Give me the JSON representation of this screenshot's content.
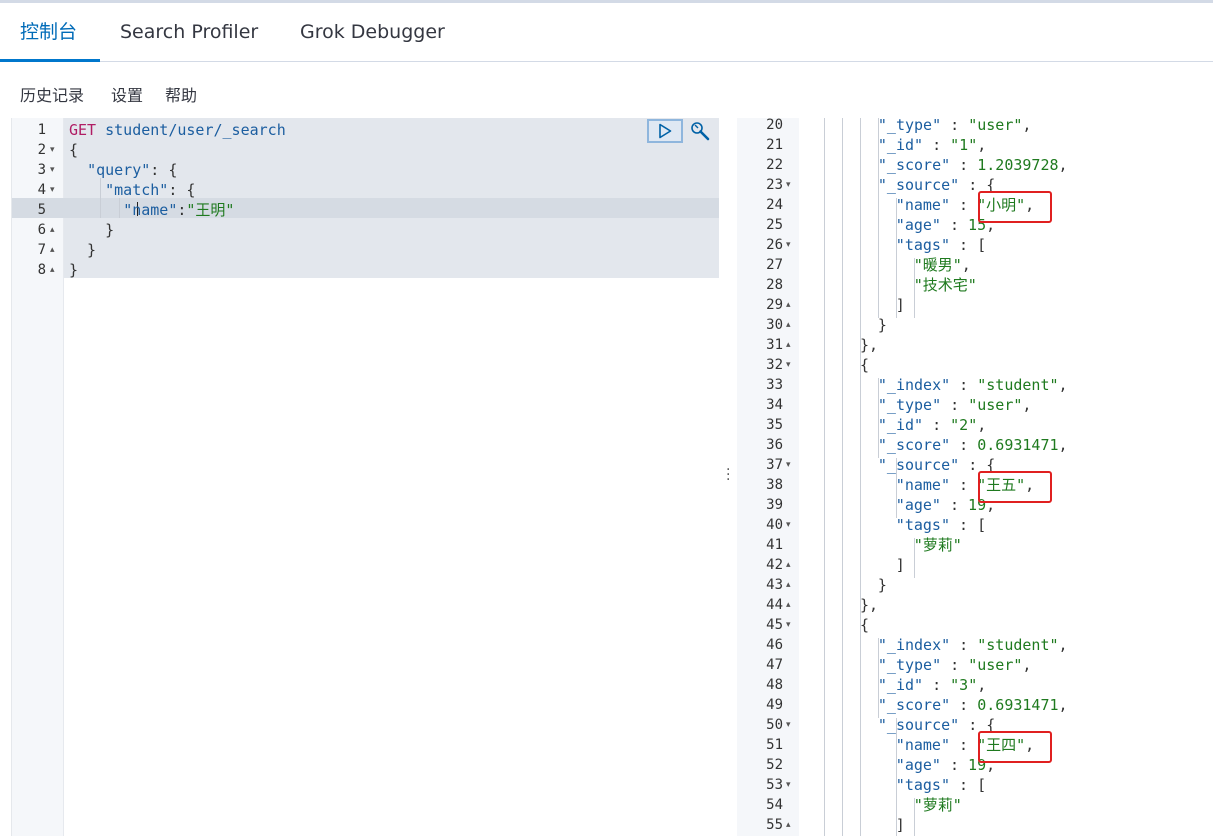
{
  "tabs": [
    {
      "label": "控制台",
      "active": true
    },
    {
      "label": "Search Profiler",
      "active": false
    },
    {
      "label": "Grok Debugger",
      "active": false
    }
  ],
  "menu": {
    "history": "历史记录",
    "settings": "设置",
    "help": "帮助"
  },
  "request": {
    "lines": [
      {
        "n": "1",
        "fold": "",
        "text": "GET student/user/_search"
      },
      {
        "n": "2",
        "fold": "▾",
        "text": "{"
      },
      {
        "n": "3",
        "fold": "▾",
        "text": "  \"query\": {"
      },
      {
        "n": "4",
        "fold": "▾",
        "text": "    \"match\": {"
      },
      {
        "n": "5",
        "fold": "",
        "text": "      \"name\":\"王明\""
      },
      {
        "n": "6",
        "fold": "▴",
        "text": "    }"
      },
      {
        "n": "7",
        "fold": "▴",
        "text": "  }"
      },
      {
        "n": "8",
        "fold": "▴",
        "text": "}"
      }
    ]
  },
  "response": {
    "lines": [
      {
        "n": "20",
        "fold": "",
        "indent": 4,
        "text": "\"_type\" : \"user\","
      },
      {
        "n": "21",
        "fold": "",
        "indent": 4,
        "text": "\"_id\" : \"1\","
      },
      {
        "n": "22",
        "fold": "",
        "indent": 4,
        "text": "\"_score\" : 1.2039728,"
      },
      {
        "n": "23",
        "fold": "▾",
        "indent": 4,
        "text": "\"_source\" : {"
      },
      {
        "n": "24",
        "fold": "",
        "indent": 5,
        "text": "\"name\" : \"小明\","
      },
      {
        "n": "25",
        "fold": "",
        "indent": 5,
        "text": "\"age\" : 15,"
      },
      {
        "n": "26",
        "fold": "▾",
        "indent": 5,
        "text": "\"tags\" : ["
      },
      {
        "n": "27",
        "fold": "",
        "indent": 6,
        "text": "\"暖男\","
      },
      {
        "n": "28",
        "fold": "",
        "indent": 6,
        "text": "\"技术宅\""
      },
      {
        "n": "29",
        "fold": "▴",
        "indent": 5,
        "text": "]"
      },
      {
        "n": "30",
        "fold": "▴",
        "indent": 4,
        "text": "}"
      },
      {
        "n": "31",
        "fold": "▴",
        "indent": 3,
        "text": "},"
      },
      {
        "n": "32",
        "fold": "▾",
        "indent": 3,
        "text": "{"
      },
      {
        "n": "33",
        "fold": "",
        "indent": 4,
        "text": "\"_index\" : \"student\","
      },
      {
        "n": "34",
        "fold": "",
        "indent": 4,
        "text": "\"_type\" : \"user\","
      },
      {
        "n": "35",
        "fold": "",
        "indent": 4,
        "text": "\"_id\" : \"2\","
      },
      {
        "n": "36",
        "fold": "",
        "indent": 4,
        "text": "\"_score\" : 0.6931471,"
      },
      {
        "n": "37",
        "fold": "▾",
        "indent": 4,
        "text": "\"_source\" : {"
      },
      {
        "n": "38",
        "fold": "",
        "indent": 5,
        "text": "\"name\" : \"王五\","
      },
      {
        "n": "39",
        "fold": "",
        "indent": 5,
        "text": "\"age\" : 19,"
      },
      {
        "n": "40",
        "fold": "▾",
        "indent": 5,
        "text": "\"tags\" : ["
      },
      {
        "n": "41",
        "fold": "",
        "indent": 6,
        "text": "\"萝莉\""
      },
      {
        "n": "42",
        "fold": "▴",
        "indent": 5,
        "text": "]"
      },
      {
        "n": "43",
        "fold": "▴",
        "indent": 4,
        "text": "}"
      },
      {
        "n": "44",
        "fold": "▴",
        "indent": 3,
        "text": "},"
      },
      {
        "n": "45",
        "fold": "▾",
        "indent": 3,
        "text": "{"
      },
      {
        "n": "46",
        "fold": "",
        "indent": 4,
        "text": "\"_index\" : \"student\","
      },
      {
        "n": "47",
        "fold": "",
        "indent": 4,
        "text": "\"_type\" : \"user\","
      },
      {
        "n": "48",
        "fold": "",
        "indent": 4,
        "text": "\"_id\" : \"3\","
      },
      {
        "n": "49",
        "fold": "",
        "indent": 4,
        "text": "\"_score\" : 0.6931471,"
      },
      {
        "n": "50",
        "fold": "▾",
        "indent": 4,
        "text": "\"_source\" : {"
      },
      {
        "n": "51",
        "fold": "",
        "indent": 5,
        "text": "\"name\" : \"王四\","
      },
      {
        "n": "52",
        "fold": "",
        "indent": 5,
        "text": "\"age\" : 19,"
      },
      {
        "n": "53",
        "fold": "▾",
        "indent": 5,
        "text": "\"tags\" : ["
      },
      {
        "n": "54",
        "fold": "",
        "indent": 6,
        "text": "\"萝莉\""
      },
      {
        "n": "55",
        "fold": "▴",
        "indent": 5,
        "text": "]"
      }
    ],
    "highlighted_lines": [
      "24",
      "38",
      "51"
    ]
  },
  "icons": {
    "run": "play-icon",
    "settings": "wrench-icon",
    "resize": "vertical-ellipsis-icon"
  },
  "colors": {
    "accent": "#006bb8",
    "highlight_box": "#e02020",
    "json_string": "#1f7a1f",
    "json_key": "#1c5ea0",
    "http_method": "#b01c64"
  }
}
